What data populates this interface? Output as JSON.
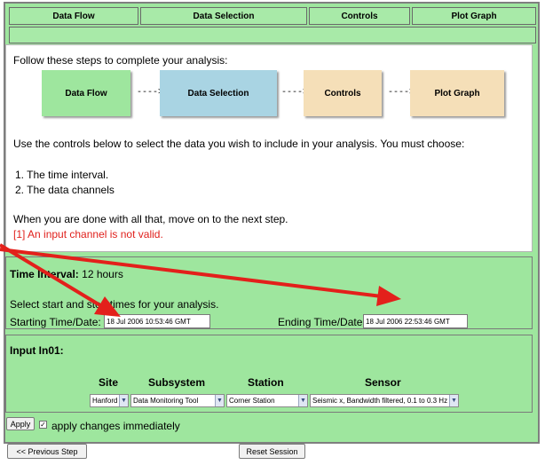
{
  "tabs": [
    {
      "label": "Data Flow"
    },
    {
      "label": "Data Selection"
    },
    {
      "label": "Controls"
    },
    {
      "label": "Plot Graph"
    }
  ],
  "intro": "Follow these steps to complete your analysis:",
  "flow": {
    "steps": [
      "Data Flow",
      "Data Selection",
      "Controls",
      "Plot Graph"
    ],
    "arrow": "---->"
  },
  "instructions": "Use the controls below to select the data you wish to include in your analysis. You must choose:",
  "steps_list": [
    "1.  The time interval.",
    "2.  The data channels"
  ],
  "done_text": "When you are done with all that, move on to the next step.",
  "error_text": "[1] An input channel is not valid.",
  "time_interval": {
    "label": "Time Interval:",
    "value": "12 hours",
    "select_text": "Select start and stop times for your analysis.",
    "start_label": "Starting Time/Date:",
    "start_value": "18 Jul 2006 10:53:46 GMT",
    "end_label": "Ending Time/Date:",
    "end_value": "18 Jul 2006 22:53:46 GMT"
  },
  "input": {
    "title": "Input In01:",
    "headers": {
      "site": "Site",
      "subsystem": "Subsystem",
      "station": "Station",
      "sensor": "Sensor"
    },
    "site": "Hanford",
    "subsystem": "Data Monitoring Tool",
    "station": "Corner Station",
    "sensor": "Seismic x, Bandwidth filtered, 0.1 to 0.3 Hz"
  },
  "apply": {
    "button": "Apply",
    "check_mark": "✓",
    "label": "apply changes immediately"
  },
  "buttons": {
    "previous": "<< Previous Step",
    "reset": "Reset Session"
  },
  "colors": {
    "panel_green": "#9ee69e",
    "selected_blue": "#a9d4e3",
    "pending_tan": "#f5dfb8",
    "error_red": "#e0201c",
    "annotation_arrow": "#e3201b"
  }
}
